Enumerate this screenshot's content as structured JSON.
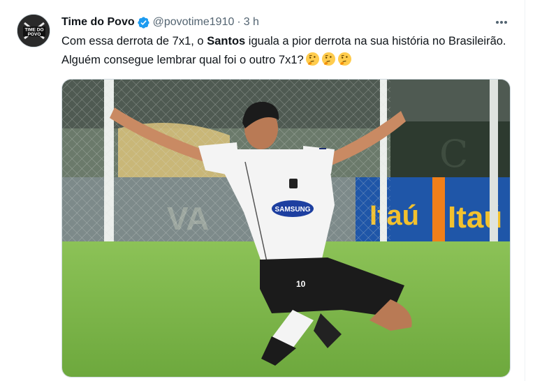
{
  "tweet": {
    "author_name": "Time do Povo",
    "handle": "@povotime1910",
    "separator": "·",
    "time": "3 h",
    "text_part1": "Com essa derrota de 7x1, o ",
    "text_bold": "Santos",
    "text_part2": " iguala a pior derrota na sua história no Brasileirão. Alguém consegue lembrar qual foi o outro 7x1?",
    "emojis": [
      "thinking-face",
      "thinking-face",
      "thinking-face"
    ]
  },
  "avatar": {
    "logo_text_line1": "TIME DO",
    "logo_text_line2": "POVO"
  },
  "media": {
    "banner_text_1": "Itaú",
    "banner_text_2": "Itaú",
    "sponsor_text": "SAMSUNG",
    "shirt_number": "10",
    "stand_letters": "VA"
  },
  "colors": {
    "verified": "#1d9bf0",
    "secondary_text": "#536471",
    "pitch": "#7fb54a",
    "banner_orange": "#f07f1a"
  }
}
